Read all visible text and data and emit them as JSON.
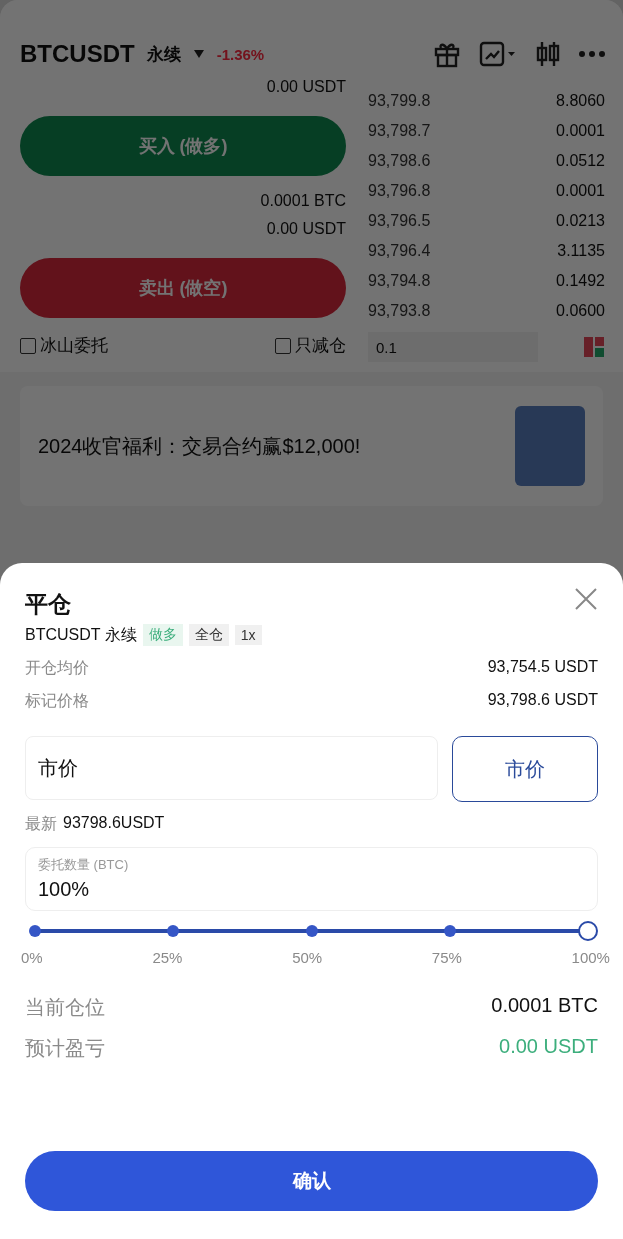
{
  "header": {
    "symbol": "BTCUSDT",
    "contract": "永续",
    "change": "-1.36%"
  },
  "trade_panel": {
    "balance_value": "0.00 USDT",
    "buy_button": "买入 (做多)",
    "position_value": "0.0001 BTC",
    "margin_value": "0.00 USDT",
    "sell_button": "卖出 (做空)",
    "options": [
      {
        "label": "冰山委托",
        "checked": false
      },
      {
        "label": "只减仓",
        "checked": false
      }
    ]
  },
  "order_book": {
    "rows": [
      {
        "price": "93,799.8",
        "size": "8.8060"
      },
      {
        "price": "93,798.7",
        "size": "0.0001"
      },
      {
        "price": "93,798.6",
        "size": "0.0512"
      },
      {
        "price": "93,796.8",
        "size": "0.0001"
      },
      {
        "price": "93,796.5",
        "size": "0.0213"
      },
      {
        "price": "93,796.4",
        "size": "3.1135"
      },
      {
        "price": "93,794.8",
        "size": "0.1492"
      },
      {
        "price": "93,793.8",
        "size": "0.0600"
      }
    ],
    "precision": "0.1"
  },
  "banner": {
    "text": "2024收官福利：交易合约赢$12,000!"
  },
  "close_sheet": {
    "title": "平仓",
    "symbol": "BTCUSDT 永续",
    "tags": [
      {
        "label": "做多",
        "kind": "long"
      },
      {
        "label": "全仓",
        "kind": "plain"
      },
      {
        "label": "1x",
        "kind": "plain"
      }
    ],
    "info": [
      {
        "label": "开仓均价",
        "value": "93,754.5 USDT"
      },
      {
        "label": "标记价格",
        "value": "93,798.6 USDT"
      }
    ],
    "price_field": {
      "value": "市价"
    },
    "market_button": "市价",
    "latest_label": "最新",
    "latest_value": "93798.6USDT",
    "quantity_field": {
      "label": "委托数量 (BTC)",
      "value": "100%"
    },
    "slider": {
      "level": 1,
      "ticks": [
        "0%",
        "25%",
        "50%",
        "75%",
        "100%"
      ]
    },
    "summary": [
      {
        "label": "当前仓位",
        "value": "0.0001 BTC",
        "kind": "plain"
      },
      {
        "label": "预计盈亏",
        "value": "0.00 USDT",
        "kind": "profit"
      }
    ],
    "confirm_button": "确认"
  }
}
